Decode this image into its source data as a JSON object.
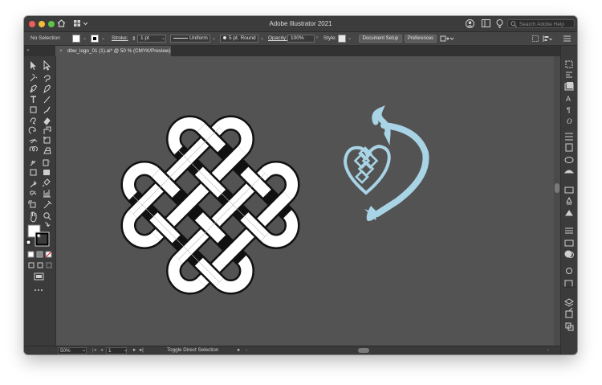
{
  "window": {
    "title": "Adobe Illustrator 2021"
  },
  "search": {
    "placeholder": "Search Adobe Help"
  },
  "control_bar": {
    "selection": "No Selection",
    "stroke_label": "Stroke:",
    "stroke_weight": "1 pt",
    "profile": "Uniform",
    "brush": "5 pt. Round",
    "opacity_label": "Opacity:",
    "opacity_value": "100%",
    "style_label": "Style:",
    "document_setup": "Document Setup",
    "preferences": "Preferences"
  },
  "tab": {
    "label": "dbw_logo_01 (1).ai* @ 50 % (CMYK/Preview)",
    "close": "×"
  },
  "status_bar": {
    "zoom": "50%",
    "artboard": "1",
    "tool_status": "Toggle Direct Selection"
  },
  "colors": {
    "fill": "#ffffff",
    "stroke": "#000000",
    "harp_logo": "#a8d4e6",
    "canvas": "#535353",
    "ui_dark": "#3b3b3b"
  },
  "toolbar_tools": [
    "selection-tool",
    "direct-selection-tool",
    "magic-wand-tool",
    "lasso-tool",
    "pen-tool",
    "curvature-tool",
    "type-tool",
    "line-tool",
    "rectangle-tool",
    "paintbrush-tool",
    "shaper-tool",
    "eraser-tool",
    "rotate-tool",
    "scale-tool",
    "width-tool",
    "free-transform-tool",
    "shape-builder-tool",
    "perspective-grid-tool",
    "mesh-tool",
    "gradient-tool",
    "eyedropper-tool",
    "blend-tool",
    "symbol-sprayer-tool",
    "graph-tool",
    "artboard-tool",
    "slice-tool",
    "hand-tool",
    "zoom-tool"
  ],
  "panel_icons": [
    "libraries",
    "properties",
    "layers",
    "character",
    "paragraph",
    "opentype",
    "align",
    "transform",
    "color",
    "swatches",
    "brushes",
    "symbols",
    "stroke",
    "gradient",
    "transparency",
    "appearance",
    "graphic-styles",
    "layers-panel",
    "export",
    "artboards"
  ]
}
